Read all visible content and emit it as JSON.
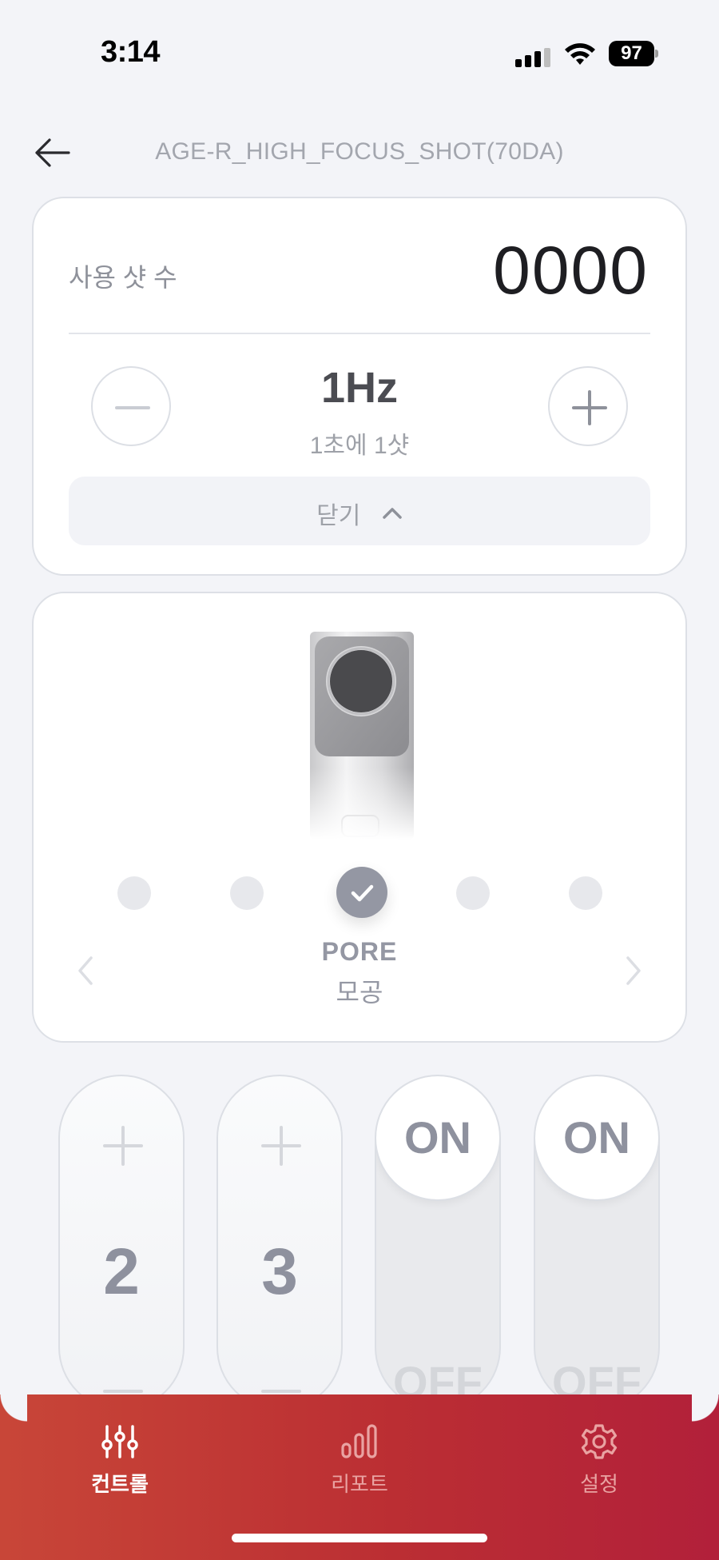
{
  "status_bar": {
    "time": "3:14",
    "battery": "97",
    "icons": [
      "cellular-signal-icon",
      "wifi-icon",
      "battery-icon"
    ]
  },
  "header": {
    "back_icon": "arrow-left-icon",
    "title": "AGE-R_HIGH_FOCUS_SHOT(70DA)"
  },
  "shots_card": {
    "label": "사용 샷 수",
    "value": "0000",
    "frequency": "1Hz",
    "frequency_desc": "1초에 1샷",
    "minus_icon": "minus-icon",
    "plus_icon": "plus-icon",
    "close_label": "닫기",
    "close_icon": "chevron-up-icon"
  },
  "mode_card": {
    "dots_count": 5,
    "selected_index": 2,
    "mode_name_en": "PORE",
    "mode_name_ko": "모공"
  },
  "controls": {
    "level_1": "2",
    "level_2": "3",
    "toggle_1_on": "ON",
    "toggle_1_off": "OFF",
    "toggle_2_on": "ON",
    "toggle_2_off": "OFF"
  },
  "nav": {
    "items": [
      {
        "label": "컨트롤",
        "icon": "sliders-icon",
        "active": true
      },
      {
        "label": "리포트",
        "icon": "bar-chart-icon",
        "active": false
      },
      {
        "label": "설정",
        "icon": "gear-icon",
        "active": false
      }
    ]
  },
  "colors": {
    "accent_gradient_start": "#c84638",
    "accent_gradient_end": "#b2203a",
    "background": "#f3f4f8",
    "text_muted": "#9497a3"
  }
}
